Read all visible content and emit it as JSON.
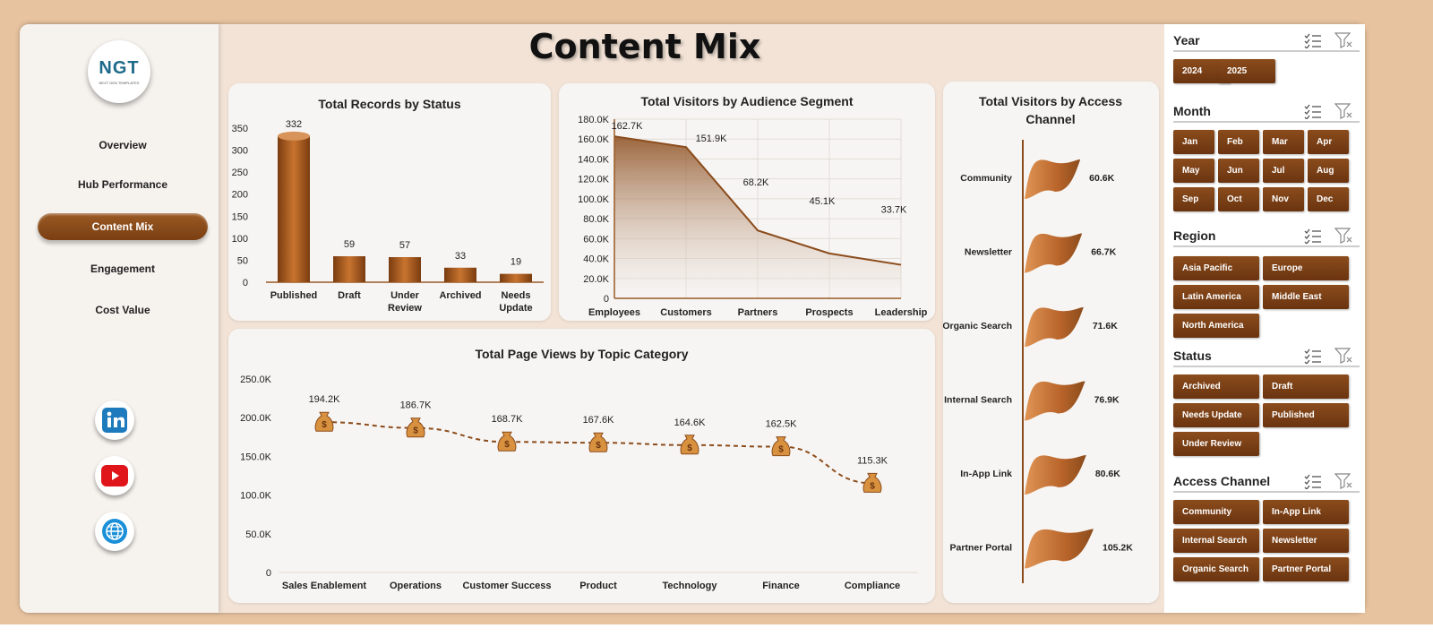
{
  "page_title": "Content Mix",
  "logo": {
    "text": "NGT",
    "subtitle": "NEXT GEN TEMPLATES"
  },
  "nav": {
    "items": [
      {
        "label": "Overview"
      },
      {
        "label": "Hub Performance"
      },
      {
        "label": "Content Mix",
        "active": true
      },
      {
        "label": "Engagement"
      },
      {
        "label": "Cost Value"
      }
    ]
  },
  "social": [
    "linkedin-icon",
    "youtube-icon",
    "globe-icon"
  ],
  "colors": {
    "accent": "#8b4c1c",
    "fill_light": "#c47a38",
    "bg": "#e8c3a0"
  },
  "chart_data": [
    {
      "type": "bar",
      "title": "Total Records by Status",
      "categories": [
        "Published",
        "Draft",
        "Under Review",
        "Archived",
        "Needs Update"
      ],
      "values": [
        332,
        59,
        57,
        33,
        19
      ],
      "yticks": [
        "0",
        "50",
        "100",
        "150",
        "200",
        "250",
        "300",
        "350"
      ],
      "ylim": [
        0,
        350
      ]
    },
    {
      "type": "area",
      "title": "Total Visitors by Audience Segment",
      "categories": [
        "Employees",
        "Customers",
        "Partners",
        "Prospects",
        "Leadership"
      ],
      "values": [
        162700,
        151900,
        68200,
        45100,
        33700
      ],
      "labels": [
        "162.7K",
        "151.9K",
        "68.2K",
        "45.1K",
        "33.7K"
      ],
      "yticks": [
        "0",
        "20.0K",
        "40.0K",
        "60.0K",
        "80.0K",
        "100.0K",
        "120.0K",
        "140.0K",
        "160.0K",
        "180.0K"
      ],
      "ylim": [
        0,
        180000
      ],
      "grid": true
    },
    {
      "type": "bar",
      "title": "Total Visitors by Access Channel",
      "categories": [
        "Community",
        "Newsletter",
        "Organic Search",
        "Internal Search",
        "In-App Link",
        "Partner Portal"
      ],
      "values": [
        60600,
        66700,
        71600,
        76900,
        80600,
        105200
      ],
      "labels": [
        "60.6K",
        "66.7K",
        "71.6K",
        "76.9K",
        "80.6K",
        "105.2K"
      ]
    },
    {
      "type": "line",
      "title": "Total Page Views by Topic Category",
      "categories": [
        "Sales Enablement",
        "Operations",
        "Customer Success",
        "Product",
        "Technology",
        "Finance",
        "Compliance"
      ],
      "values": [
        194200,
        186700,
        168700,
        167600,
        164600,
        162500,
        115300
      ],
      "labels": [
        "194.2K",
        "186.7K",
        "168.7K",
        "167.6K",
        "164.6K",
        "162.5K",
        "115.3K"
      ],
      "yticks": [
        "0",
        "50.0K",
        "100.0K",
        "150.0K",
        "200.0K",
        "250.0K"
      ],
      "ylim": [
        0,
        250000
      ],
      "marker": "money-bag-icon"
    }
  ],
  "slicers": [
    {
      "title": "Year",
      "items": [
        "2024",
        "2025"
      ]
    },
    {
      "title": "Month",
      "items": [
        "Jan",
        "Feb",
        "Mar",
        "Apr",
        "May",
        "Jun",
        "Jul",
        "Aug",
        "Sep",
        "Oct",
        "Nov",
        "Dec"
      ]
    },
    {
      "title": "Region",
      "items": [
        "Asia Pacific",
        "Europe",
        "Latin America",
        "Middle East",
        "North America"
      ]
    },
    {
      "title": "Status",
      "items": [
        "Archived",
        "Draft",
        "Needs Update",
        "Published",
        "Under Review"
      ]
    },
    {
      "title": "Access Channel",
      "items": [
        "Community",
        "In-App Link",
        "Internal Search",
        "Newsletter",
        "Organic Search",
        "Partner Portal"
      ]
    }
  ]
}
